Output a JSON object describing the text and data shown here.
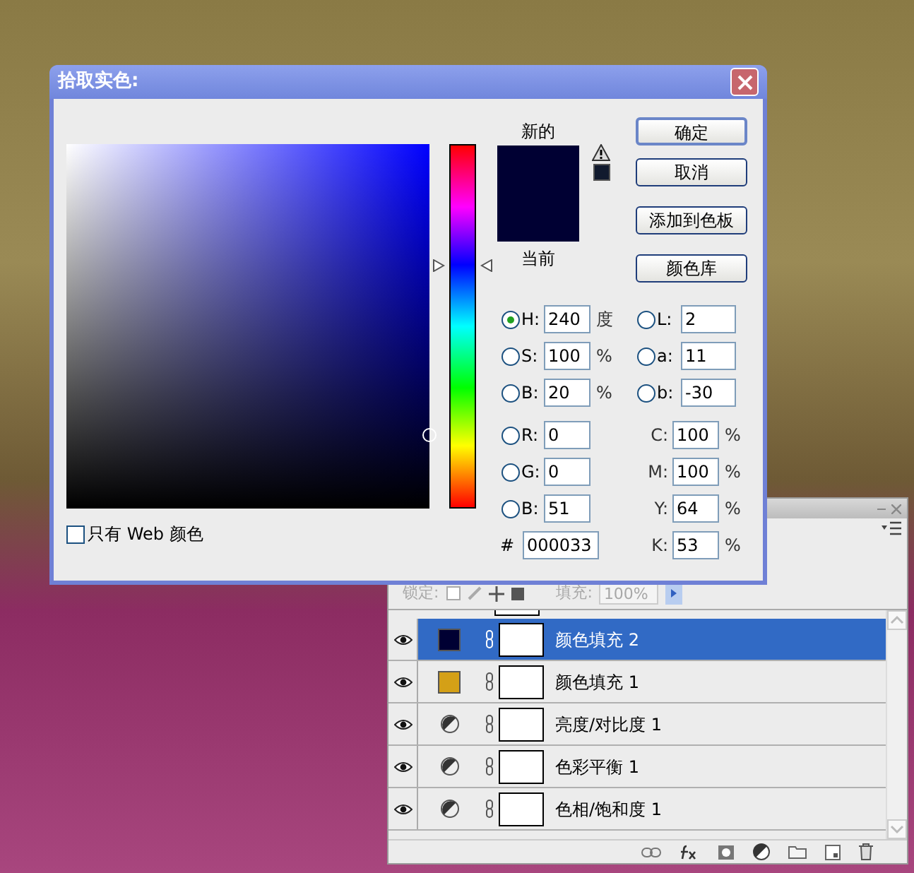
{
  "dialog": {
    "title": "拾取实色:",
    "new_label": "新的",
    "current_label": "当前",
    "hue_slider": {
      "level": 0.667
    },
    "buttons": [
      {
        "label": "确定",
        "default": true
      },
      {
        "label": "取消",
        "default": false
      },
      {
        "label": "添加到色板",
        "default": false
      },
      {
        "label": "颜色库",
        "default": false
      }
    ],
    "left_fields": [
      {
        "kind": "radio",
        "label": "H:",
        "value": "240",
        "unit": "度",
        "selected": true
      },
      {
        "kind": "radio",
        "label": "S:",
        "value": "100",
        "unit": "%",
        "selected": false
      },
      {
        "kind": "radio",
        "label": "B:",
        "value": "20",
        "unit": "%",
        "selected": false
      },
      {
        "kind": "radio",
        "label": "R:",
        "value": "0",
        "selected": false
      },
      {
        "kind": "radio",
        "label": "G:",
        "value": "0",
        "selected": false
      },
      {
        "kind": "radio",
        "label": "B:",
        "value": "51",
        "selected": false
      },
      {
        "kind": "hex",
        "label": "#",
        "value": "000033"
      }
    ],
    "right_fields": [
      {
        "kind": "radio",
        "label": "L:",
        "value": "2",
        "selected": false
      },
      {
        "kind": "radio",
        "label": "a:",
        "value": "11",
        "selected": false
      },
      {
        "kind": "radio",
        "label": "b:",
        "value": "-30",
        "selected": false
      },
      {
        "kind": "plain",
        "label": "C:",
        "value": "100",
        "unit": "%"
      },
      {
        "kind": "plain",
        "label": "M:",
        "value": "100",
        "unit": "%"
      },
      {
        "kind": "plain",
        "label": "Y:",
        "value": "64",
        "unit": "%"
      },
      {
        "kind": "plain",
        "label": "K:",
        "value": "53",
        "unit": "%"
      }
    ],
    "web_only": {
      "label": "只有 Web 颜色",
      "checked": false
    }
  },
  "layers_panel": {
    "lock_label": "锁定:",
    "fill_label": "填充:",
    "fill_value": "100%",
    "layers": [
      {
        "kind": "fill",
        "name": "颜色填充 2",
        "color": "#000033",
        "selected": true
      },
      {
        "kind": "fill",
        "name": "颜色填充 1",
        "color": "#d4a017",
        "selected": false
      },
      {
        "kind": "adjustment",
        "name": "亮度/对比度 1",
        "selected": false
      },
      {
        "kind": "adjustment",
        "name": "色彩平衡 1",
        "selected": false
      },
      {
        "kind": "adjustment",
        "name": "色相/饱和度 1",
        "selected": false
      }
    ]
  }
}
